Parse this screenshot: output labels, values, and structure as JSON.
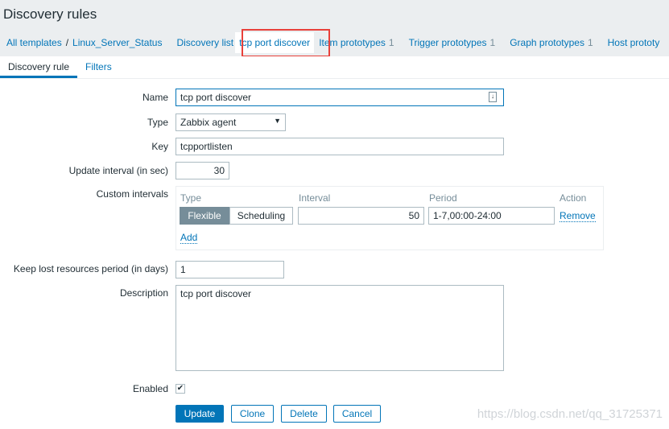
{
  "title": "Discovery rules",
  "breadcrumb": {
    "all_templates": "All templates",
    "template": "Linux_Server_Status",
    "discovery_list": "Discovery list",
    "current": "tcp port discover",
    "items": [
      {
        "label": "Item prototypes",
        "count": "1"
      },
      {
        "label": "Trigger prototypes",
        "count": "1"
      },
      {
        "label": "Graph prototypes",
        "count": "1"
      },
      {
        "label": "Host prototy",
        "count": ""
      }
    ]
  },
  "tabs": [
    "Discovery rule",
    "Filters"
  ],
  "form": {
    "name_label": "Name",
    "name": "tcp port discover",
    "type_label": "Type",
    "type": "Zabbix agent",
    "key_label": "Key",
    "key": "tcpportlisten",
    "update_label": "Update interval (in sec)",
    "update": "30",
    "custom_label": "Custom intervals",
    "ci_headers": [
      "Type",
      "Interval",
      "Period",
      "Action"
    ],
    "ci_flexible": "Flexible",
    "ci_scheduling": "Scheduling",
    "ci_interval": "50",
    "ci_period": "1-7,00:00-24:00",
    "ci_remove": "Remove",
    "ci_add": "Add",
    "keep_label": "Keep lost resources period (in days)",
    "keep": "1",
    "desc_label": "Description",
    "desc": "tcp port discover",
    "enabled_label": "Enabled",
    "enabled": true
  },
  "buttons": {
    "update": "Update",
    "clone": "Clone",
    "delete": "Delete",
    "cancel": "Cancel"
  },
  "watermark": "https://blog.csdn.net/qq_31725371"
}
